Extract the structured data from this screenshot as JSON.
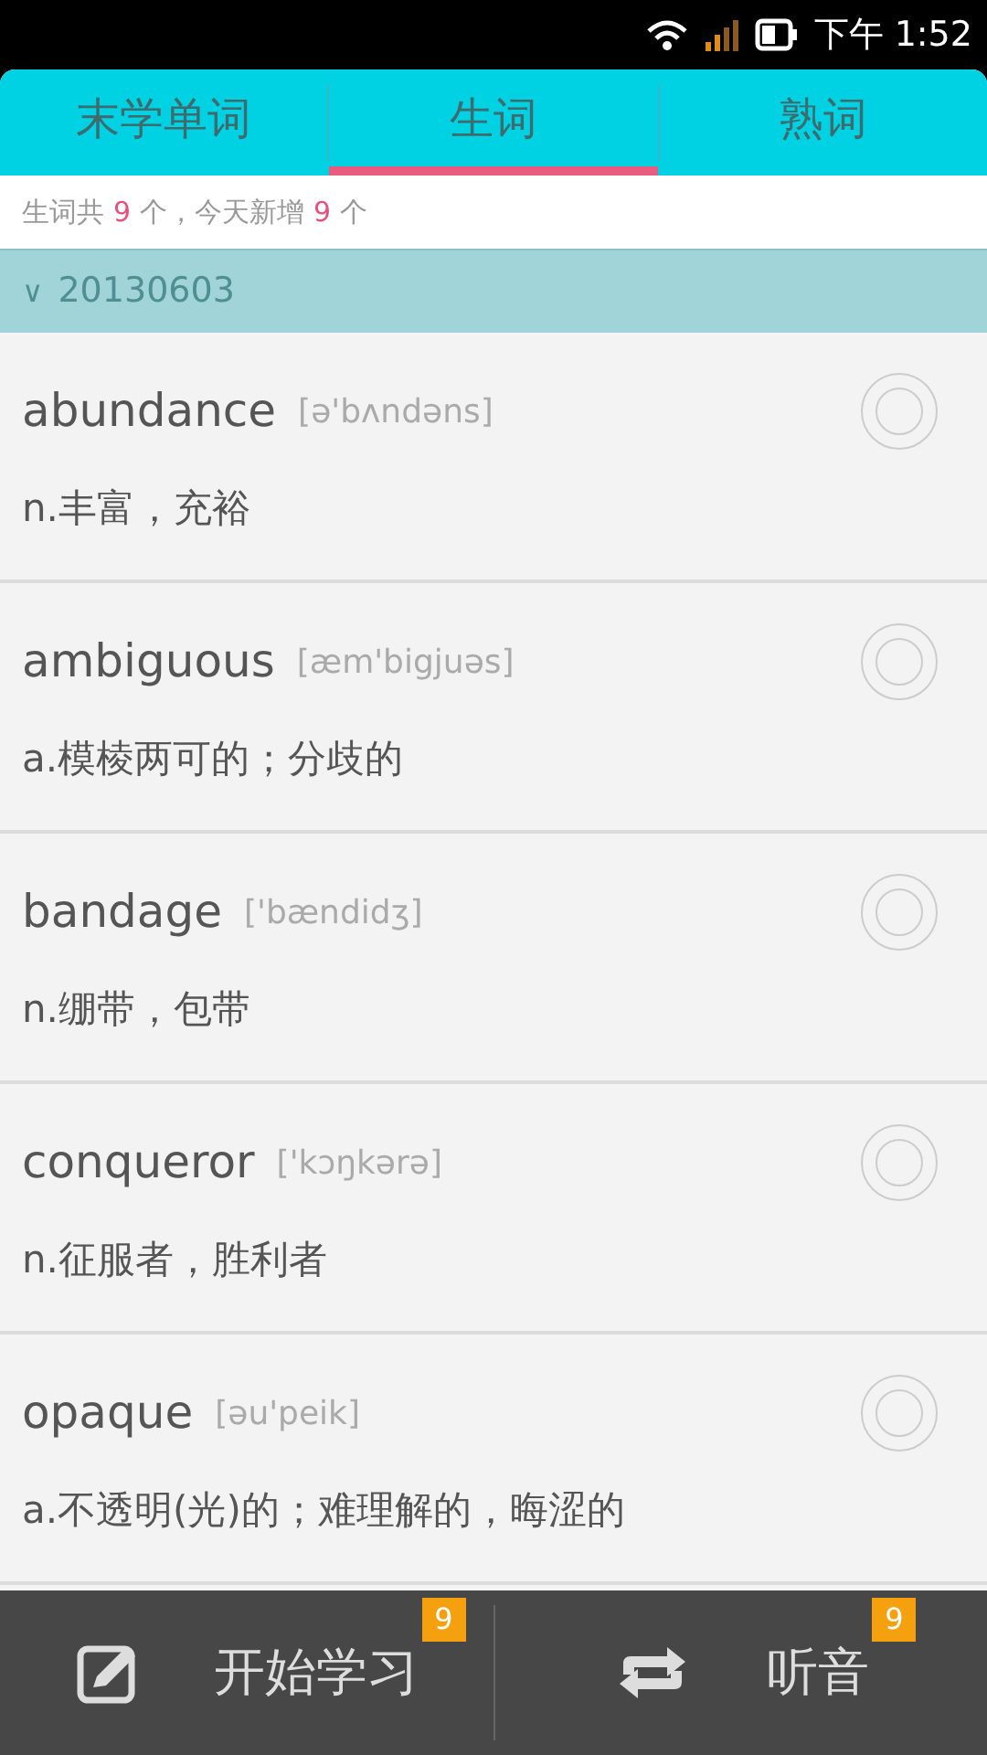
{
  "status_bar": {
    "time": "下午 1:52"
  },
  "tabs": [
    {
      "label": "末学单词",
      "selected": false
    },
    {
      "label": "生词",
      "selected": true
    },
    {
      "label": "熟词",
      "selected": false
    }
  ],
  "summary": [
    {
      "text": "生词共",
      "highlight": false
    },
    {
      "text": "9",
      "highlight": true
    },
    {
      "text": "个，今天新增",
      "highlight": false
    },
    {
      "text": "9",
      "highlight": true
    },
    {
      "text": "个",
      "highlight": false
    }
  ],
  "group": {
    "caret": "∨",
    "date": "20130603",
    "expanded": true
  },
  "words": [
    {
      "word": "abundance",
      "phonetic": "[ə'bʌndəns]",
      "definition": "n.丰富，充裕",
      "checked": false
    },
    {
      "word": "ambiguous",
      "phonetic": "[æm'bigjuəs]",
      "definition": "a.模棱两可的；分歧的",
      "checked": false
    },
    {
      "word": "bandage",
      "phonetic": "['bændidʒ]",
      "definition": "n.绷带，包带",
      "checked": false
    },
    {
      "word": "conqueror",
      "phonetic": "['kɔŋkərə]",
      "definition": "n.征服者，胜利者",
      "checked": false
    },
    {
      "word": "opaque",
      "phonetic": "[əu'peik]",
      "definition": "a.不透明(光)的；难理解的，晦涩的",
      "checked": false
    }
  ],
  "bottom_bar": [
    {
      "label": "开始学习",
      "badge": "9",
      "kind": "study"
    },
    {
      "label": "听音",
      "badge": "9",
      "kind": "listen"
    }
  ]
}
